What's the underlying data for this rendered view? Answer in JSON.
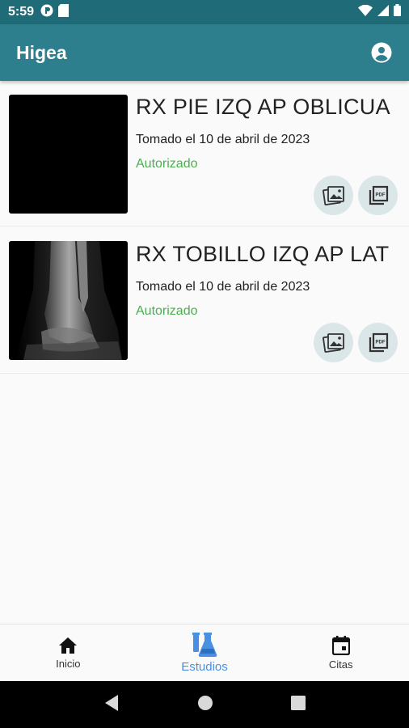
{
  "status_bar": {
    "time": "5:59",
    "left_icons": [
      "app-notification-icon",
      "sd-card-icon"
    ],
    "right_icons": [
      "wifi-icon",
      "cellular-icon",
      "battery-icon"
    ]
  },
  "app_bar": {
    "title": "Higea",
    "account_icon": "account-circle-icon"
  },
  "studies": [
    {
      "title": "RX PIE IZQ AP OBLICUA",
      "date": "Tomado el 10 de abril de 2023",
      "status": "Autorizado",
      "thumbnail": "black-image",
      "actions": [
        "image-gallery-icon",
        "pdf-icon"
      ]
    },
    {
      "title": "RX TOBILLO IZQ AP LAT",
      "date": "Tomado el 10 de abril de 2023",
      "status": "Autorizado",
      "thumbnail": "ankle-xray-image",
      "actions": [
        "image-gallery-icon",
        "pdf-icon"
      ]
    }
  ],
  "bottom_nav": {
    "items": [
      {
        "label": "Inicio",
        "icon": "home-icon",
        "active": false
      },
      {
        "label": "Estudios",
        "icon": "lab-flask-icon",
        "active": true
      },
      {
        "label": "Citas",
        "icon": "calendar-icon",
        "active": false
      }
    ]
  },
  "system_nav": [
    "back-icon",
    "home-circle-icon",
    "recents-icon"
  ],
  "colors": {
    "status_bar": "#1f6b77",
    "app_bar": "#2e7f8d",
    "status_authorized": "#4caf50",
    "nav_active": "#4a90e2",
    "action_bg": "#dbe6e8"
  }
}
